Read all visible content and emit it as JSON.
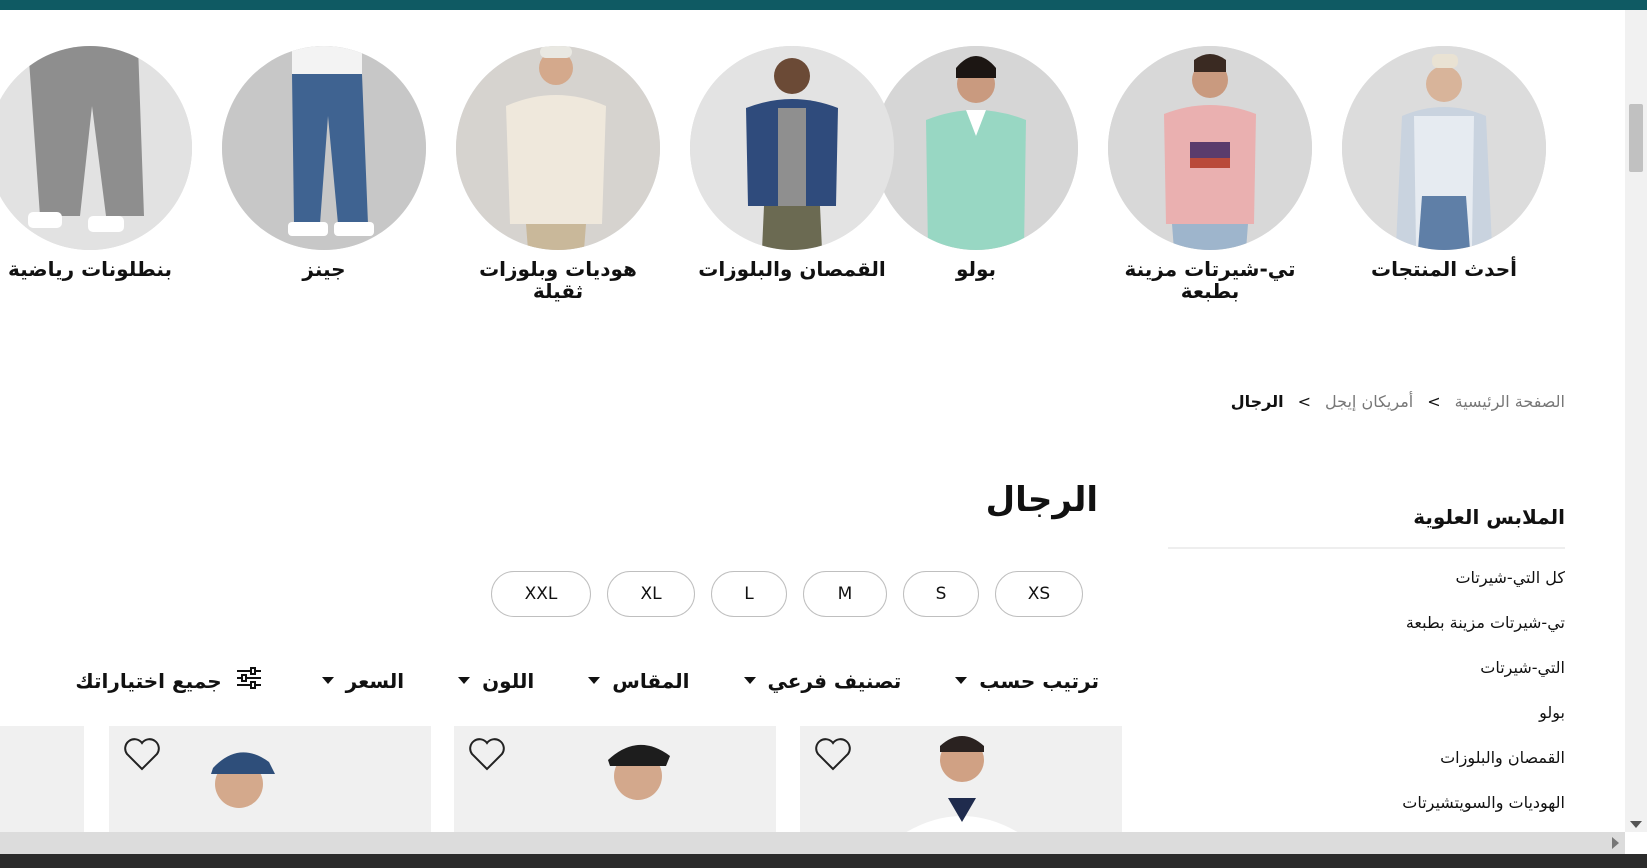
{
  "categories": [
    {
      "label": "أحدث المنتجات"
    },
    {
      "label": "تي-شيرتات مزينة بطبعة"
    },
    {
      "label": "بولو"
    },
    {
      "label": "القمصان والبلوزات"
    },
    {
      "label": "هوديات وبلوزات ثقيلة"
    },
    {
      "label": "جينز"
    },
    {
      "label": "بنطلونات رياضية"
    }
  ],
  "breadcrumb": {
    "home": "الصفحة الرئيسية",
    "separator": ">",
    "brand": "أمريكان إيجل",
    "current": "الرجال"
  },
  "sidebar": {
    "title": "الملابس العلوية",
    "items": [
      {
        "label": "كل التي-شيرتات"
      },
      {
        "label": "تي-شيرتات مزينة بطبعة"
      },
      {
        "label": "التي-شيرتات"
      },
      {
        "label": "بولو"
      },
      {
        "label": "القمصان والبلوزات"
      },
      {
        "label": "الهوديات والسويتشيرتات"
      }
    ]
  },
  "page_title": "الرجال",
  "sizes": [
    "XS",
    "S",
    "M",
    "L",
    "XL",
    "XXL"
  ],
  "filters": {
    "sort": "ترتيب حسب",
    "subcategory": "تصنيف فرعي",
    "size": "المقاس",
    "color": "اللون",
    "price": "السعر",
    "all": "جميع اختياراتك"
  },
  "icons": {
    "wishlist": "heart-icon",
    "filter": "sliders-icon",
    "dropdown": "caret-down-icon"
  },
  "colors": {
    "topbar": "#0f5a63"
  }
}
